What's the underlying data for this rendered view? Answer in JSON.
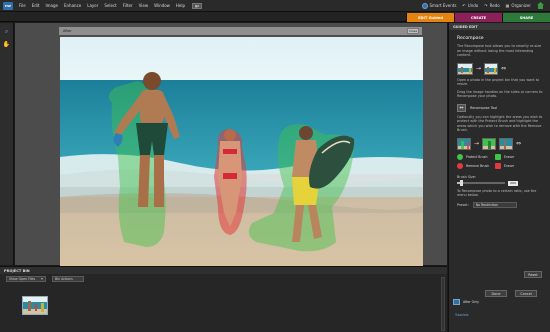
{
  "app": {
    "logo_text": "PSE"
  },
  "menu": [
    "File",
    "Edit",
    "Image",
    "Enhance",
    "Layer",
    "Select",
    "Filter",
    "View",
    "Window",
    "Help"
  ],
  "topbar": {
    "event_label": "Smart Events",
    "undo_label": "Undo",
    "redo_label": "Redo",
    "organizer_label": "Organizer"
  },
  "tabs": {
    "edit": "EDIT Guided",
    "create": "CREATE",
    "share": "SHARE"
  },
  "document": {
    "title": "After",
    "close_label": "Close"
  },
  "bin": {
    "header": "PROJECT BIN",
    "source_select": "Show Open Files",
    "actions_label": "Bin Actions"
  },
  "panel": {
    "header": "GUIDED EDIT",
    "title": "Recompose",
    "intro": "The Recompose tool allows you to smartly re-size an image without losing the most interesting content.",
    "step_open": "Open a photo in the project bin that you want to resize.",
    "step_drag": "Drag the image handles on the sides or corners to Recompose your photo.",
    "recompose_tool_label": "Recompose Tool",
    "optional_text": "Optionally you can highlight the areas you wish to protect with the Protect Brush and highlight the areas which you wish to remove with the Remove Brush.",
    "brushes": [
      "Protect Brush",
      "Eraser",
      "Remove Brush",
      "Eraser"
    ],
    "brush_size_label": "Brush Size:",
    "brush_size_value": "200",
    "brush_size_level": 0.08,
    "preset_text": "To Recompose photo to a certain ratio, use the menu below.",
    "preset_label": "Preset:",
    "preset_value": "No Restriction",
    "reset_label": "Reset",
    "done_label": "Done",
    "cancel_label": "Cancel",
    "view_label": "After Only",
    "tutorials_label": "Tutorials"
  },
  "colors": {
    "edit_tab": "#e5830f",
    "create_tab": "#8c2058",
    "share_tab": "#2e7a3b",
    "protect": "#3fc34a",
    "remove": "#e33b3b"
  }
}
